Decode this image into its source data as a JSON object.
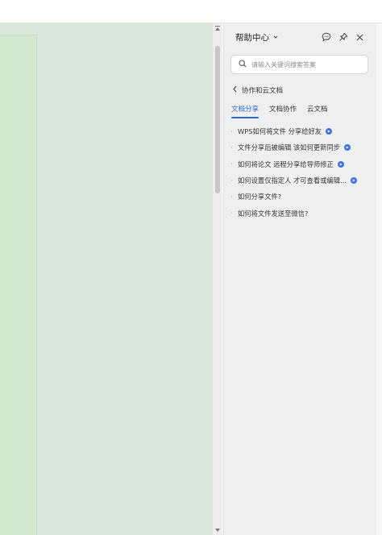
{
  "help_panel": {
    "title": "帮助中心",
    "search": {
      "placeholder": "请输入关键词搜索答案"
    },
    "breadcrumb": "协作和云文档",
    "tabs": [
      {
        "label": "文档分享",
        "active": true
      },
      {
        "label": "文档协作",
        "active": false
      },
      {
        "label": "云文档",
        "active": false
      }
    ],
    "questions": [
      {
        "text": "WPS如何将文件 分享给好友",
        "video": true
      },
      {
        "text": "文件分享后被编辑 该如何更新同步",
        "video": true
      },
      {
        "text": "如何将论文 远程分享给导师修正",
        "video": true
      },
      {
        "text": "如何设置仅指定人 才可查看或编辑...",
        "video": true
      },
      {
        "text": "如何分享文件?",
        "video": false
      },
      {
        "text": "如何将文件发送至微信?",
        "video": false
      }
    ],
    "icons": {
      "dropdown": "chevron-down-icon",
      "feedback": "chat-bubble-icon",
      "pin": "pin-icon",
      "close": "close-icon",
      "search": "search-icon",
      "back": "chevron-left-icon",
      "video": "play-badge-icon"
    }
  },
  "colors": {
    "accent": "#2d6cd7",
    "video_badge": "#3c73de",
    "document_background": "#d9e7dd",
    "document_page": "#d1e8cf",
    "panel_background": "#efefef"
  }
}
